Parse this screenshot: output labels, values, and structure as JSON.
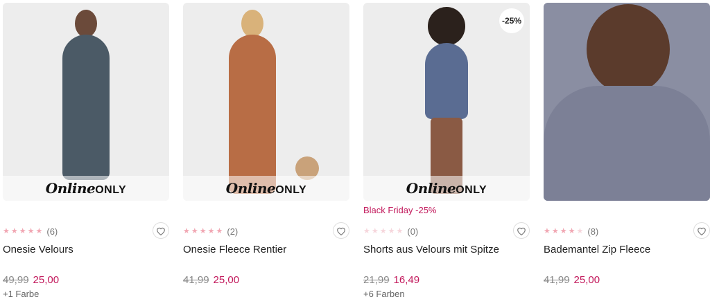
{
  "products": [
    {
      "online_only": {
        "script": "Online",
        "caps": "ONLY"
      },
      "rating_count": "(6)",
      "name": "Onesie Velours",
      "old_price": "49,99",
      "new_price": "25,00",
      "colors": "+1 Farbe",
      "rating": 5
    },
    {
      "online_only": {
        "script": "Online",
        "caps": "ONLY"
      },
      "rating_count": "(2)",
      "name": "Onesie Fleece Rentier",
      "old_price": "41,99",
      "new_price": "25,00",
      "rating": 5
    },
    {
      "online_only": {
        "script": "Online",
        "caps": "ONLY"
      },
      "discount_badge": "-25%",
      "promo": "Black Friday -25%",
      "rating_count": "(0)",
      "name": "Shorts aus Velours mit Spitze",
      "old_price": "21,99",
      "new_price": "16,49",
      "colors": "+6 Farben",
      "rating": 0
    },
    {
      "rating_count": "(8)",
      "name": "Bademantel Zip Fleece",
      "old_price": "41,99",
      "new_price": "25,00",
      "rating": 4.5
    }
  ],
  "icons": {
    "star": "star-icon",
    "wishlist": "heart-icon"
  },
  "colors": {
    "sale": "#c2185b",
    "star": "#f1a7b3"
  }
}
